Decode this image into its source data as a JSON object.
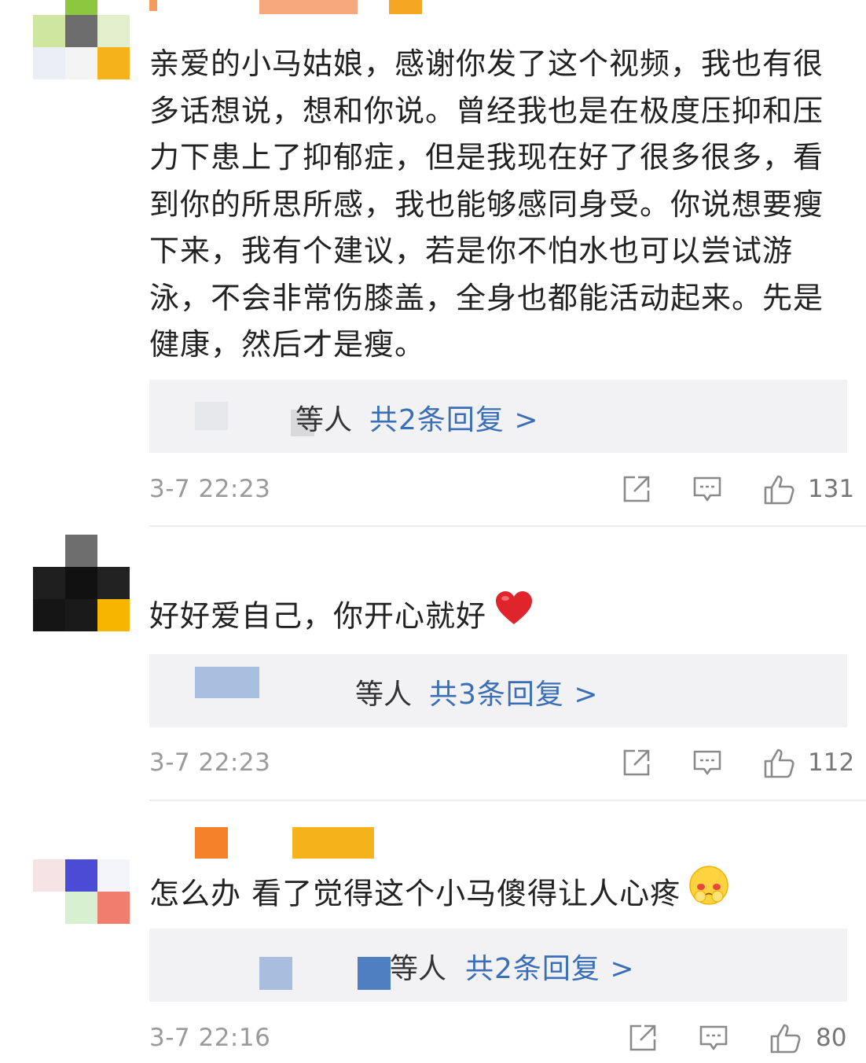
{
  "comments": [
    {
      "text": "亲爱的小马姑娘，感谢你发了这个视频，我也有很多话想说，想和你说。曾经我也是在极度压抑和压力下患上了抑郁症，但是我现在好了很多很多，看到你的所思所感，我也能够感同身受。你说想要瘦下来，我有个建议，若是你不怕水也可以尝试游泳，不会非常伤膝盖，全身也都能活动起来。先是健康，然后才是瘦。",
      "emoji": "",
      "reply_suffix": "等人",
      "reply_link": "共2条回复 >",
      "time": "3-7 22:23",
      "likes": "131"
    },
    {
      "text": "好好爱自己，你开心就好",
      "emoji": "heart-emoji",
      "reply_suffix": "等人",
      "reply_link": "共3条回复 >",
      "time": "3-7 22:23",
      "likes": "112"
    },
    {
      "text": "怎么办 看了觉得这个小马傻得让人心疼",
      "emoji": "shy-face-emoji",
      "reply_suffix": "等人",
      "reply_link": "共2条回复 >",
      "time": "3-7 22:16",
      "likes": "80"
    }
  ],
  "colors": {
    "link": "#3a6fb8",
    "timestamp": "#9a9a9a",
    "reply_box": "#f2f2f4",
    "heart": "#e0242b"
  },
  "icons": [
    "share-icon",
    "comment-icon",
    "like-icon"
  ]
}
